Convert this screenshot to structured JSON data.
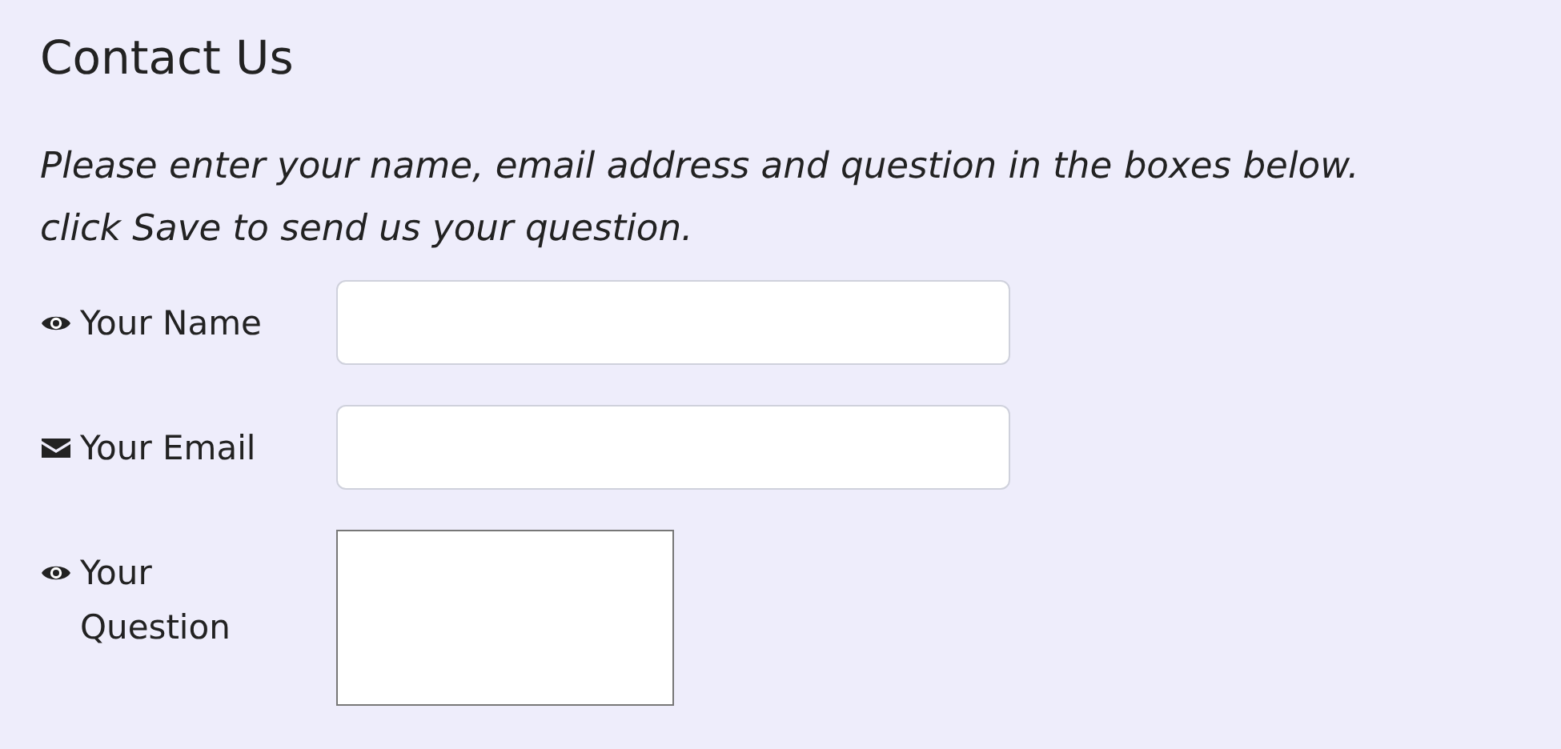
{
  "title": "Contact Us",
  "instructions": "Please enter your name, email address and question in the boxes below. click Save to send us your question.",
  "fields": [
    {
      "kind": "text",
      "label": "Your Name"
    },
    {
      "kind": "email",
      "label": "Your Email"
    },
    {
      "kind": "textarea",
      "label": "Your Question"
    }
  ]
}
